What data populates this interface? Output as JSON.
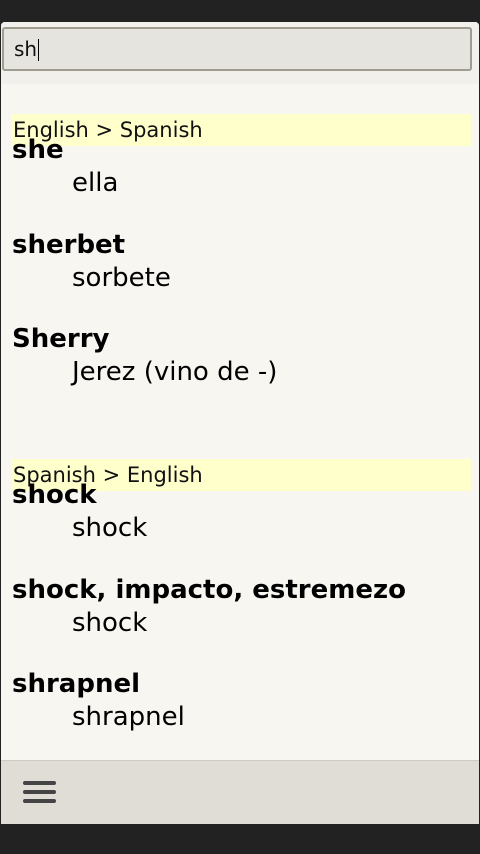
{
  "search": {
    "value": "sh"
  },
  "sections": [
    {
      "header": "English > Spanish",
      "entries": [
        {
          "term": "she",
          "definition": "ella"
        },
        {
          "term": "sherbet",
          "definition": "sorbete"
        },
        {
          "term": "Sherry",
          "definition": "Jerez (vino de -)"
        }
      ]
    },
    {
      "header": "Spanish > English",
      "entries": [
        {
          "term": "shock",
          "definition": "shock"
        },
        {
          "term": "shock, impacto, estremezo",
          "definition": "shock"
        },
        {
          "term": "shrapnel",
          "definition": "shrapnel"
        }
      ]
    }
  ],
  "toolbar": {
    "menu_icon": "hamburger-menu-icon"
  },
  "colors": {
    "section_header_bg": "#ffffcc",
    "content_bg": "#f8f6f1",
    "bottom_bar_bg": "#e0ddd6"
  }
}
